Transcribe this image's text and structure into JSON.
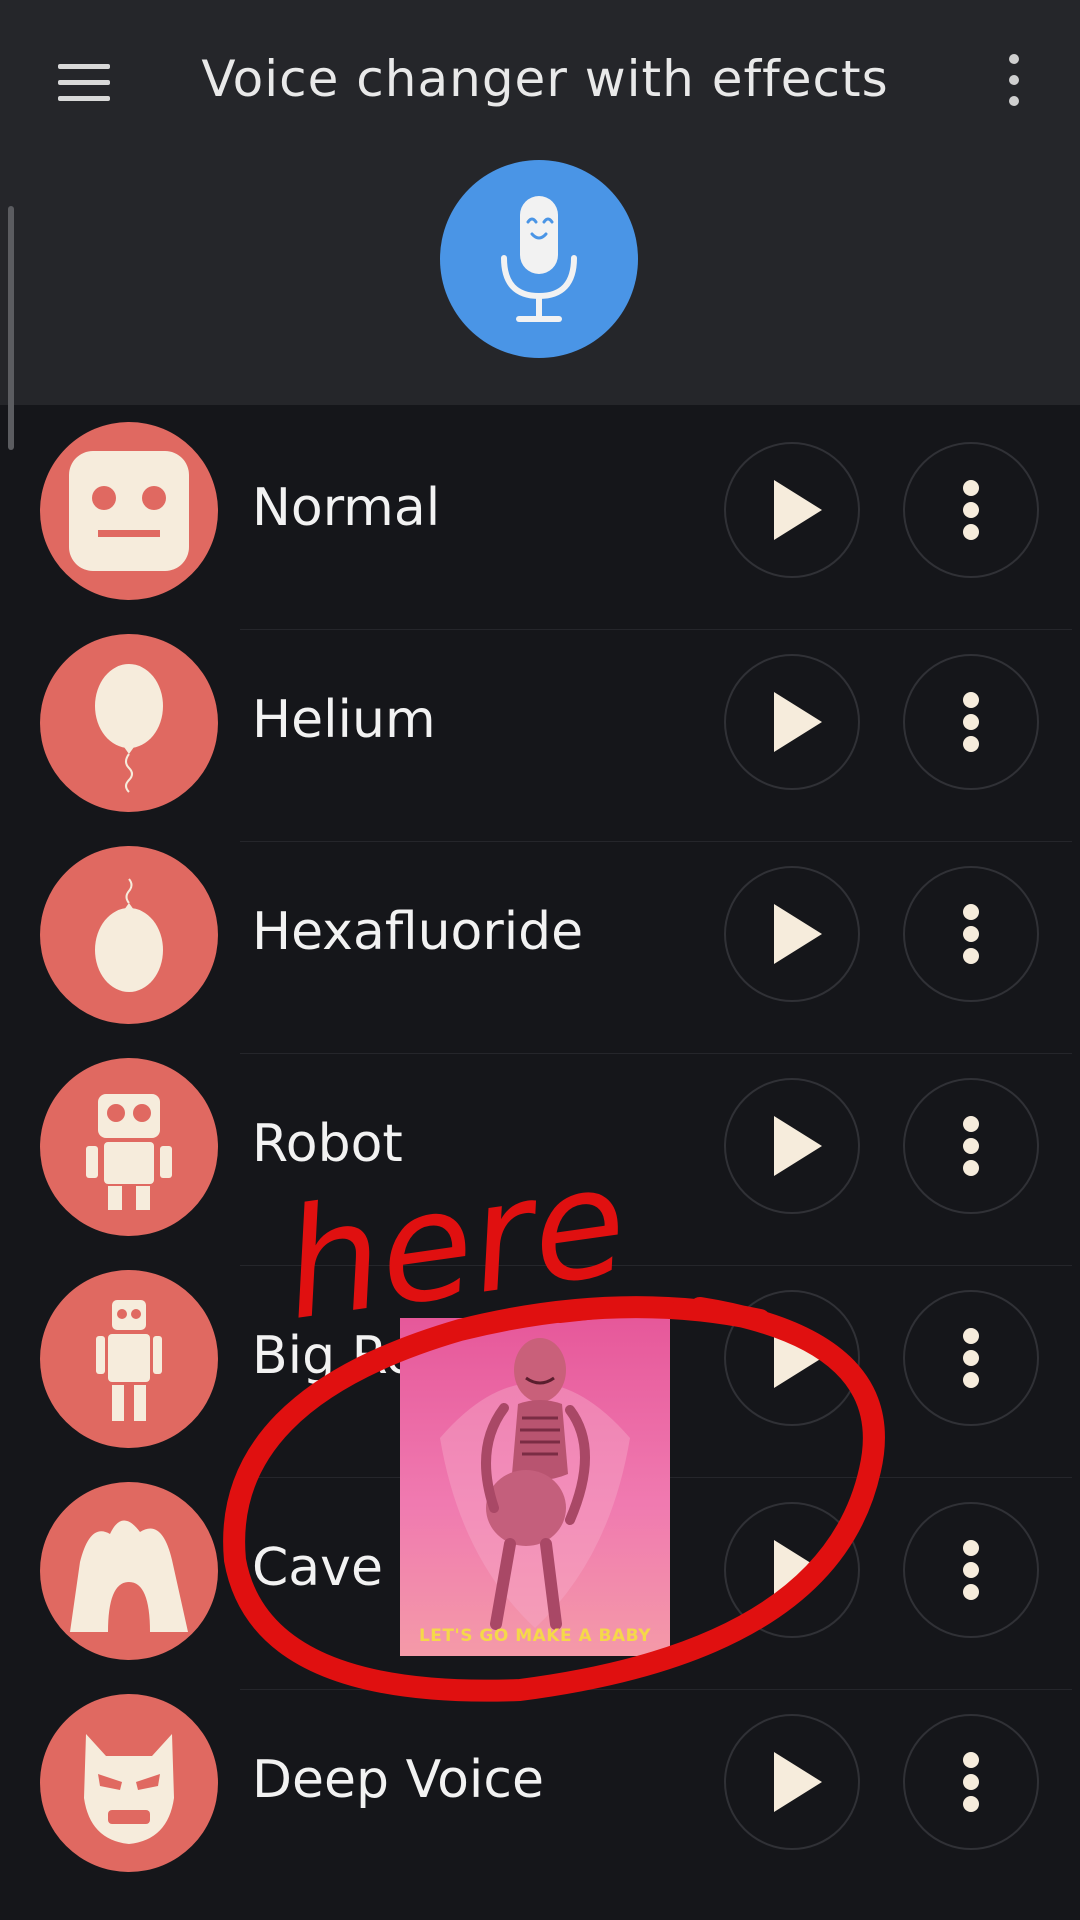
{
  "app_bar": {
    "title": "Voice changer with effects",
    "menu_icon": "hamburger-menu-icon",
    "overflow_icon": "vertical-dots-icon",
    "record_icon": "microphone-icon",
    "accent_color": "#4a95e6"
  },
  "effects": [
    {
      "label": "Normal",
      "icon": "robot-face-icon"
    },
    {
      "label": "Helium",
      "icon": "balloon-icon"
    },
    {
      "label": "Hexafluoride",
      "icon": "heavy-balloon-icon"
    },
    {
      "label": "Robot",
      "icon": "robot-icon"
    },
    {
      "label": "Big Ro",
      "icon": "big-robot-icon"
    },
    {
      "label": "Cave",
      "icon": "cave-icon"
    },
    {
      "label": "Deep Voice",
      "icon": "masked-face-icon"
    }
  ],
  "row_actions": {
    "play_icon": "play-icon",
    "more_icon": "vertical-dots-icon"
  },
  "overlay": {
    "annotation_text": "here",
    "caption": "LET'S GO MAKE A BABY",
    "annotation_color": "#e01010"
  },
  "colors": {
    "background": "#15161a",
    "top_bar": "#25262a",
    "effect_icon_bg": "#e06961"
  }
}
